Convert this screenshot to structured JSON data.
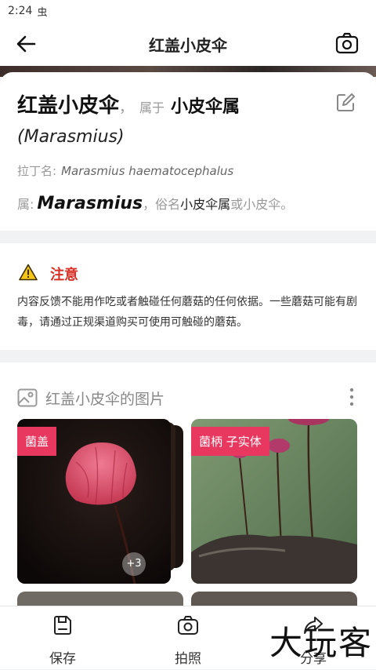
{
  "status_bar": {
    "time": "2:24",
    "extra": "虫"
  },
  "top_bar": {
    "title": "红盖小皮伞"
  },
  "header": {
    "name": "红盖小皮伞",
    "comma": "，",
    "belongs_to": "属于",
    "genus_cn": "小皮伞属",
    "genus_latin": "(Marasmius)",
    "latin_label": "拉丁名:",
    "latin_value": "Marasmius haematocephalus",
    "genus_label": "属:",
    "genus_value": "Marasmius",
    "genus_alias_prefix": "，俗名",
    "alias1": "小皮伞属",
    "alias_or": "或",
    "alias2": "小皮伞。"
  },
  "warning": {
    "title": "注意",
    "text": "内容反馈不能用作吃或者触碰任何蘑菇的任何依据。一些蘑菇可能有剧毒，请通过正规渠道购买可使用可触碰的蘑菇。"
  },
  "gallery": {
    "title": "红盖小皮伞的图片",
    "tiles": [
      {
        "tag": "菌盖",
        "badge": "+3"
      },
      {
        "tag": "菌柄 子实体"
      }
    ]
  },
  "bottom_nav": {
    "items": [
      {
        "label": "保存",
        "icon": "save-icon"
      },
      {
        "label": "拍照",
        "icon": "camera-icon"
      },
      {
        "label": "分享",
        "icon": "share-icon"
      }
    ]
  },
  "watermark": "大玩客",
  "colors": {
    "accent_red": "#d93025",
    "tag_pink": "#e8385f"
  }
}
